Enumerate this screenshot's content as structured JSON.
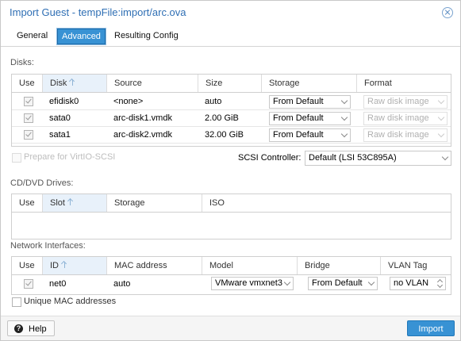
{
  "window": {
    "title": "Import Guest - tempFile:import/arc.ova"
  },
  "tabs": [
    {
      "label": "General"
    },
    {
      "label": "Advanced"
    },
    {
      "label": "Resulting Config"
    }
  ],
  "disks": {
    "section_label": "Disks:",
    "columns": [
      "Use",
      "Disk",
      "Source",
      "Size",
      "Storage",
      "Format"
    ],
    "rows": [
      {
        "disk": "efidisk0",
        "source": "<none>",
        "size": "auto",
        "storage": "From Default",
        "format": "Raw disk image"
      },
      {
        "disk": "sata0",
        "source": "arc-disk1.vmdk",
        "size": "2.00 GiB",
        "storage": "From Default",
        "format": "Raw disk image"
      },
      {
        "disk": "sata1",
        "source": "arc-disk2.vmdk",
        "size": "32.00 GiB",
        "storage": "From Default",
        "format": "Raw disk image"
      }
    ],
    "prepare_label": "Prepare for VirtIO-SCSI",
    "scsi_label": "SCSI Controller:",
    "scsi_value": "Default (LSI 53C895A)"
  },
  "cd": {
    "section_label": "CD/DVD Drives:",
    "columns": [
      "Use",
      "Slot",
      "Storage",
      "ISO"
    ]
  },
  "net": {
    "section_label": "Network Interfaces:",
    "columns": [
      "Use",
      "ID",
      "MAC address",
      "Model",
      "Bridge",
      "VLAN Tag"
    ],
    "rows": [
      {
        "id": "net0",
        "mac": "auto",
        "model": "VMware vmxnet3",
        "bridge": "From Default",
        "vlan": "no VLAN"
      }
    ],
    "unique_mac_label": "Unique MAC addresses"
  },
  "footer": {
    "help_label": "Help",
    "import_label": "Import"
  },
  "colors": {
    "accent": "#3892d4",
    "title": "#2f6fb4"
  }
}
